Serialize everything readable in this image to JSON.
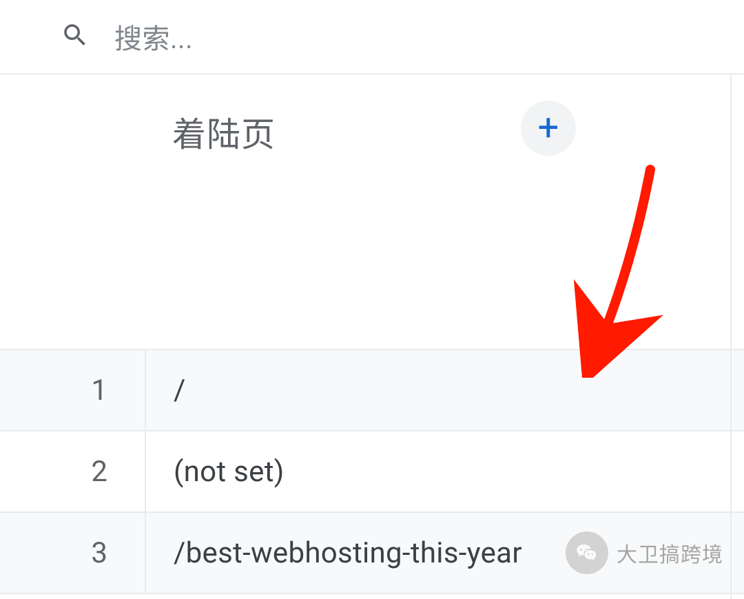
{
  "search": {
    "placeholder": "搜索..."
  },
  "header": {
    "column_title": "着陆页"
  },
  "rows": [
    {
      "index": "1",
      "value": "/"
    },
    {
      "index": "2",
      "value": "(not set)"
    },
    {
      "index": "3",
      "value": "/best-webhosting-this-year"
    }
  ],
  "watermark": {
    "text": "大卫搞跨境"
  }
}
